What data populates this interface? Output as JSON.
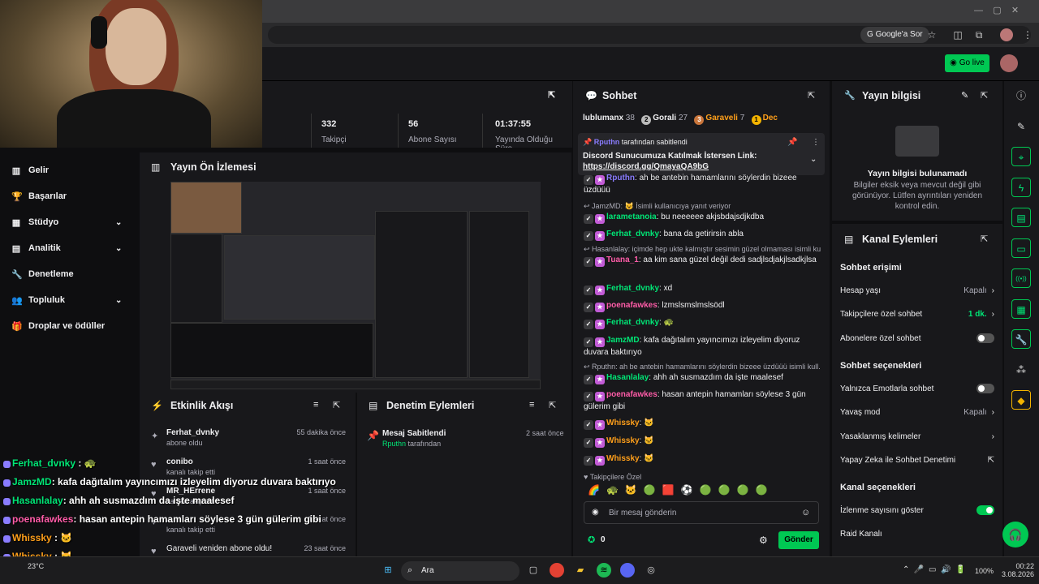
{
  "browser": {
    "google_sor": "Google'a Sor"
  },
  "header": {
    "go_live": "Go live"
  },
  "stats": [
    {
      "value": "332",
      "label": "Takipçi"
    },
    {
      "value": "56",
      "label": "Abone Sayısı"
    },
    {
      "value": "01:37:55",
      "label": "Yayında Olduğu Süre"
    }
  ],
  "nav": [
    {
      "label": "Gelir",
      "icon": "chart-icon",
      "chevron": false
    },
    {
      "label": "Başarılar",
      "icon": "trophy-icon",
      "chevron": false
    },
    {
      "label": "Stüdyo",
      "icon": "studio-icon",
      "chevron": true
    },
    {
      "label": "Analitik",
      "icon": "analytics-icon",
      "chevron": true
    },
    {
      "label": "Denetleme",
      "icon": "wrench-icon",
      "chevron": false
    },
    {
      "label": "Topluluk",
      "icon": "community-icon",
      "chevron": true
    },
    {
      "label": "Droplar ve ödüller",
      "icon": "gift-icon",
      "chevron": false
    }
  ],
  "preview": {
    "title": "Yayın Ön İzlemesi"
  },
  "activity": {
    "title": "Etkinlik Akışı",
    "items": [
      {
        "name": "Ferhat_dvnky",
        "sub": "abone oldu",
        "time": "55 dakika önce"
      },
      {
        "name": "conibo",
        "sub": "kanalı takip etti",
        "time": "1 saat önce"
      },
      {
        "name": "MR_HErrene",
        "sub": "kanalı takip etti",
        "time": "1 saat önce"
      },
      {
        "name": "",
        "sub": "kanalı takip etti",
        "time": "1 saat önce"
      },
      {
        "name": "Garaveli veniden abone oldu!",
        "sub": "",
        "time": "23 saat önce"
      }
    ]
  },
  "moderation": {
    "title": "Denetim Eylemleri",
    "items": [
      {
        "name": "Mesaj Sabitlendi",
        "by": "Rputhn",
        "suffix": "tarafından",
        "time": "2 saat önce"
      }
    ]
  },
  "chat": {
    "title": "Sohbet",
    "leaderboard": [
      {
        "name": "lublumanx",
        "count": "38"
      },
      {
        "name": "Gorali",
        "count": "27"
      },
      {
        "name": "Garaveli",
        "count": "7"
      },
      {
        "name": "Dec",
        "count": ""
      }
    ],
    "pinned": {
      "by": "Rputhn",
      "suffix": "tarafından sabitlendi",
      "text": "Discord Sunucumuza Katılmak İstersen Link:",
      "link": "https://discord.gg/QmayaQA9bG"
    },
    "messages": [
      {
        "type": "msg",
        "user": "Rputhn",
        "color": "#8a7cff",
        "text": "ah be antebin hamamlarını söylerdin bizeee üzdüüü"
      },
      {
        "type": "sys",
        "text": "JamzMD: 😺 İsimli kullanıcıya yanıt veriyor"
      },
      {
        "type": "msg",
        "user": "larametanoia",
        "color": "#00e676",
        "text": "bu neeeeee akjsbdajsdjkdba"
      },
      {
        "type": "msg",
        "user": "Ferhat_dvnky",
        "color": "#00e676",
        "text": "bana da getirirsin abla"
      },
      {
        "type": "sys",
        "text": "Hasanlalay: içimde hep ukte kalmıştır sesimin güzel olmaması isimli ku..."
      },
      {
        "type": "msg",
        "user": "Tuana_1",
        "color": "#ff5ca8",
        "text": "aa kim sana güzel değil dedi sadjlsdjakjlsadkjlsa"
      },
      {
        "type": "msg",
        "user": "Ferhat_dvnky",
        "color": "#00e676",
        "text": "xd"
      },
      {
        "type": "msg",
        "user": "poenafawkes",
        "color": "#ff5ca8",
        "text": "lzmslsmslmslsödl"
      },
      {
        "type": "msg",
        "user": "Ferhat_dvnky",
        "color": "#00e676",
        "text": "🐢"
      },
      {
        "type": "msg",
        "user": "JamzMD",
        "color": "#00e676",
        "text": "kafa dağıtalım yayıncımızı izleyelim diyoruz duvara baktırıyo"
      },
      {
        "type": "sys",
        "text": "Rputhn: ah be antebin hamamlarını söylerdin bizeee üzdüüü isimli kull..."
      },
      {
        "type": "msg",
        "user": "Hasanlalay",
        "color": "#00e676",
        "text": "ahh ah susmazdım da işte maalesef"
      },
      {
        "type": "msg",
        "user": "poenafawkes",
        "color": "#ff5ca8",
        "text": "hasan antepin hamamları söylese 3 gün gülerim gibi"
      },
      {
        "type": "msg",
        "user": "Whissky",
        "color": "#ff9f1a",
        "text": "🐱"
      },
      {
        "type": "msg",
        "user": "Whissky",
        "color": "#ff9f1a",
        "text": "🐱"
      },
      {
        "type": "msg",
        "user": "Whissky",
        "color": "#ff9f1a",
        "text": "🐱"
      }
    ],
    "followers_only": "Takipçilere Özel",
    "input_placeholder": "Bir mesaj gönderin",
    "points": "0",
    "send": "Gönder"
  },
  "info": {
    "title": "Yayın bilgisi",
    "empty_title": "Yayın bilgisi bulunamadı",
    "empty_text": "Bilgiler eksik veya mevcut değil gibi görünüyor. Lütfen ayrıntıları yeniden kontrol edin."
  },
  "channel": {
    "title": "Kanal Eylemleri",
    "section1": "Sohbet erişimi",
    "rows1": [
      {
        "label": "Hesap yaşı",
        "value": "Kapalı",
        "kind": "chev"
      },
      {
        "label": "Takipçilere özel sohbet",
        "value": "1 dk.",
        "kind": "chev-green"
      },
      {
        "label": "Abonelere özel sohbet",
        "value": "",
        "kind": "toggle-off"
      }
    ],
    "section2": "Sohbet seçenekleri",
    "rows2": [
      {
        "label": "Yalnızca Emotlarla sohbet",
        "value": "",
        "kind": "toggle-off"
      },
      {
        "label": "Yavaş mod",
        "value": "Kapalı",
        "kind": "chev"
      },
      {
        "label": "Yasaklanmış kelimeler",
        "value": "",
        "kind": "chev"
      },
      {
        "label": "Yapay Zeka ile Sohbet Denetimi",
        "value": "",
        "kind": "ext"
      }
    ],
    "section3": "Kanal seçenekleri",
    "rows3": [
      {
        "label": "İzlenme sayısını göster",
        "value": "",
        "kind": "toggle-on"
      },
      {
        "label": "Raid Kanalı",
        "value": "",
        "kind": "none"
      }
    ]
  },
  "overlay_chat": [
    {
      "user": "Ferhat_dvnky",
      "color": "#00e676",
      "text": " : 🐢"
    },
    {
      "user": "JamzMD",
      "color": "#00e676",
      "text": ": kafa dağıtalım yayıncımızı izleyelim diyoruz duvara baktırıyo"
    },
    {
      "user": "Hasanlalay",
      "color": "#00e676",
      "text": ": ahh ah susmazdım da işte maalesef"
    },
    {
      "user": "poenafawkes",
      "color": "#ff5ca8",
      "text": ": hasan antepin hamamları söylese 3 gün gülerim gibi"
    },
    {
      "user": "Whissky",
      "color": "#ff9f1a",
      "text": " : 🐱"
    },
    {
      "user": "Whissky",
      "color": "#ff9f1a",
      "text": " : 🐱"
    },
    {
      "user": "Whissky",
      "color": "#ff9f1a",
      "text": " : 🐱"
    }
  ],
  "taskbar": {
    "search": "Ara",
    "weather": "23°C",
    "battery": "100%",
    "time": "00:22",
    "date": "3.08.2026"
  }
}
